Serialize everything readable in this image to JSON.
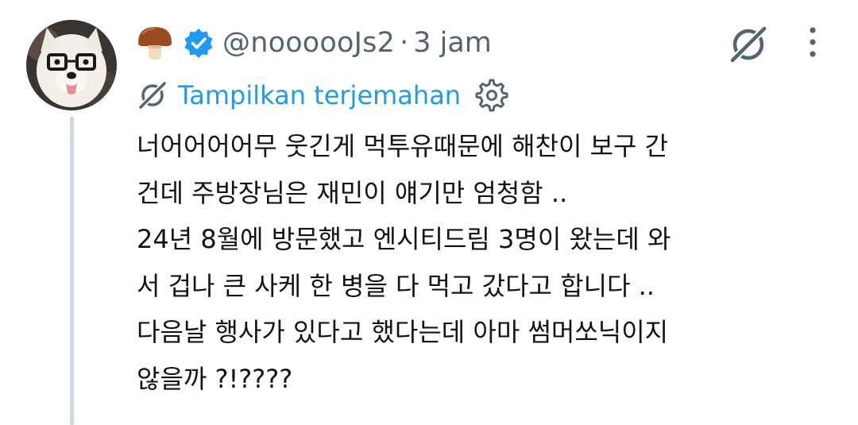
{
  "tweet": {
    "handle": "@noooooJs2",
    "separator": "·",
    "timestamp": "3 jam",
    "translate_label": "Tampilkan terjemahan",
    "text_lines": [
      "너어어어어무 웃긴게 먹투유때문에 해찬이 보구 간",
      "건데 주방장님은 재민이 얘기만 엄청함 ..",
      "24년 8월에 방문했고 엔시티드림 3명이 왔는데 와",
      "서 겁나 큰 사케 한 병을 다 먹고 갔다고 합니다 ..",
      "다음날 행사가 있다고 했다는데 아마 썸머쏘닉이지",
      "않을까 ?!????"
    ]
  },
  "icons": {
    "avatar": "samoyed-dog-with-glasses-avatar",
    "name_emoji": "mushroom-emoji",
    "verified": "verified-badge-icon",
    "grok": "grok-icon",
    "more": "more-vertical-icon",
    "translate": "translate-icon",
    "settings": "gear-icon"
  },
  "colors": {
    "accent": "#1d9bf0",
    "secondary_text": "#536471",
    "primary_text": "#0f1419",
    "thread_line": "#cfd9de",
    "verified_badge": "#1d9bf0"
  }
}
